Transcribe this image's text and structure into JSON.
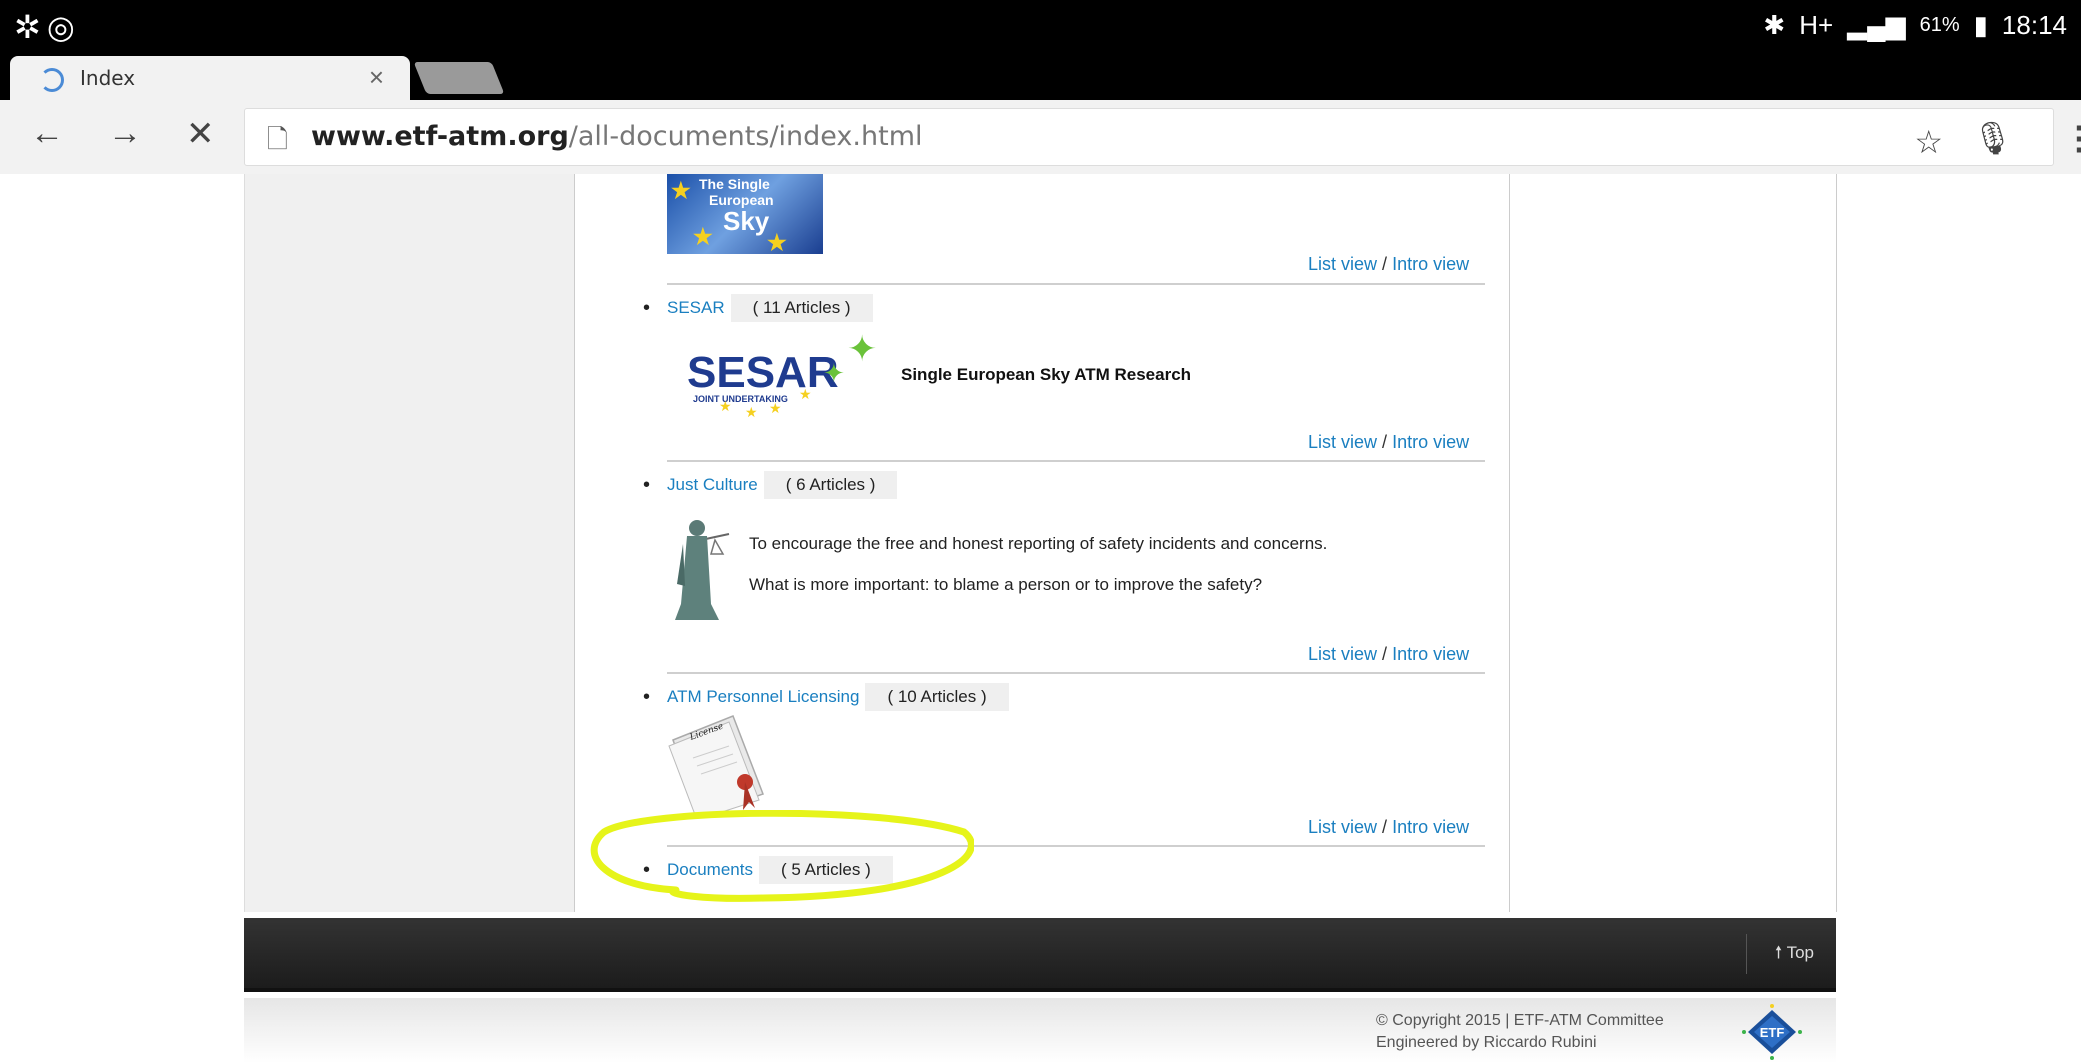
{
  "status_bar": {
    "time": "18:14",
    "battery": "61%",
    "network": "H+"
  },
  "browser": {
    "tab_title": "Index",
    "url_domain": "www.etf-atm.org",
    "url_path": "/all-documents/index.html"
  },
  "sky_image": {
    "line1": "The Single",
    "line2": "European",
    "line3": "Sky"
  },
  "list_view": "List view",
  "separator": "/",
  "intro_view": "Intro view",
  "categories": [
    {
      "label": "SESAR",
      "count": "( 11 Articles )"
    },
    {
      "label": "Just Culture",
      "count": "( 6 Articles )"
    },
    {
      "label": "ATM Personnel Licensing",
      "count": "( 10 Articles )"
    },
    {
      "label": "Documents",
      "count": "( 5 Articles )"
    }
  ],
  "sesar": {
    "logo_text": "SESAR",
    "logo_sub": "JOINT UNDERTAKING",
    "description": "Single European Sky ATM Research"
  },
  "just_culture": {
    "line1": "To encourage the free and honest reporting of safety incidents and concerns.",
    "line2": "What is more important: to blame a person or to improve the safety?"
  },
  "license_label": "License",
  "footer": {
    "top_label": "Top",
    "copyright": "© Copyright 2015 | ETF-ATM Committee",
    "engineered": "Engineered by Riccardo Rubini",
    "logo_text": "ETF"
  },
  "colors": {
    "link": "#1a7fc0",
    "highlight": "#e6f41a"
  }
}
